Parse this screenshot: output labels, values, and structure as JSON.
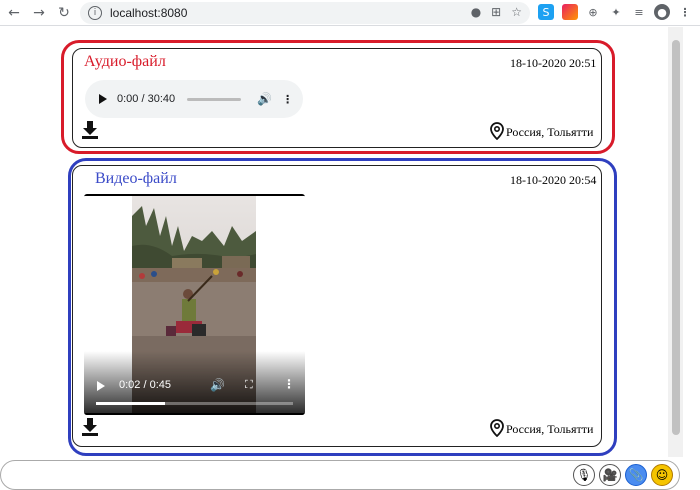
{
  "browser": {
    "url": "localhost:8080",
    "back_icon": "back-arrow-icon",
    "forward_icon": "forward-arrow-icon",
    "reload_icon": "reload-icon"
  },
  "audio_card": {
    "title": "Аудио-файл",
    "date": "18-10-2020 20:51",
    "location": "Россия, Тольятти",
    "border_color": "#d81b2a",
    "title_color": "#d81b2a",
    "player": {
      "time": "0:00 / 30:40",
      "progress": 0
    }
  },
  "video_card": {
    "title": "Видео-файл",
    "date": "18-10-2020 20:54",
    "location": "Россия, Тольятти",
    "border_color": "#2f3fbf",
    "title_color": "#3b4bc8",
    "player": {
      "time": "0:02 / 0:45",
      "progress": 0.35
    }
  },
  "composer": {
    "value": ""
  }
}
